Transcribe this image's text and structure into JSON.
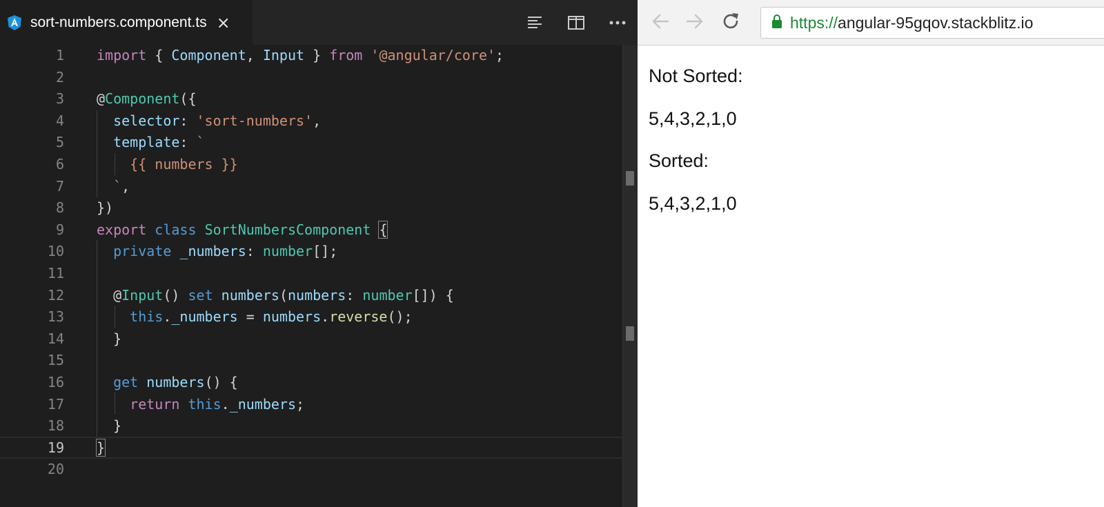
{
  "editor": {
    "tab": {
      "title": "sort-numbers.component.ts",
      "close": "×",
      "file_icon": "angular-icon"
    },
    "actions": [
      "outline-icon",
      "split-editor-icon",
      "more-icon"
    ],
    "line_numbers": [
      "1",
      "2",
      "3",
      "4",
      "5",
      "6",
      "7",
      "8",
      "9",
      "10",
      "11",
      "12",
      "13",
      "14",
      "15",
      "16",
      "17",
      "18",
      "19",
      "20"
    ],
    "code": {
      "l1": [
        "import",
        " { ",
        "Component",
        ", ",
        "Input",
        " } ",
        "from",
        " ",
        "'@angular/core'",
        ";"
      ],
      "l3": [
        "@",
        "Component",
        "({"
      ],
      "l4": [
        "selector",
        ": ",
        "'sort-numbers'",
        ","
      ],
      "l5": [
        "template",
        ": ",
        "`"
      ],
      "l6": [
        "{{ numbers }}"
      ],
      "l7": [
        "`",
        ","
      ],
      "l8": [
        "})"
      ],
      "l9": [
        "export",
        " ",
        "class",
        " ",
        "SortNumbersComponent",
        " ",
        "{"
      ],
      "l10": [
        "private",
        " ",
        "_numbers",
        ": ",
        "number",
        "[];"
      ],
      "l12": [
        "@",
        "Input",
        "() ",
        "set",
        " ",
        "numbers",
        "(",
        "numbers",
        ": ",
        "number",
        "[]) {"
      ],
      "l13": [
        "this",
        ".",
        "_numbers",
        " = ",
        "numbers",
        ".",
        "reverse",
        "();"
      ],
      "l14": [
        "}"
      ],
      "l16": [
        "get",
        " ",
        "numbers",
        "() {"
      ],
      "l17": [
        "return",
        " ",
        "this",
        ".",
        "_numbers",
        ";"
      ],
      "l18": [
        "}"
      ],
      "l19": [
        "}"
      ]
    }
  },
  "browser": {
    "url_scheme": "https://",
    "url_host": "angular-95gqov.stackblitz.io",
    "content": {
      "not_sorted_label": "Not Sorted:",
      "not_sorted_value": "5,4,3,2,1,0",
      "sorted_label": "Sorted:",
      "sorted_value": "5,4,3,2,1,0"
    }
  },
  "colors": {
    "editor_bg": "#1e1e1e",
    "keyword_purple": "#c586c0",
    "keyword_blue": "#569cd6",
    "type_teal": "#4ec9b0",
    "string": "#ce9178",
    "property": "#9cdcfe",
    "function": "#dcdcaa",
    "url_green": "#1a8a34"
  }
}
